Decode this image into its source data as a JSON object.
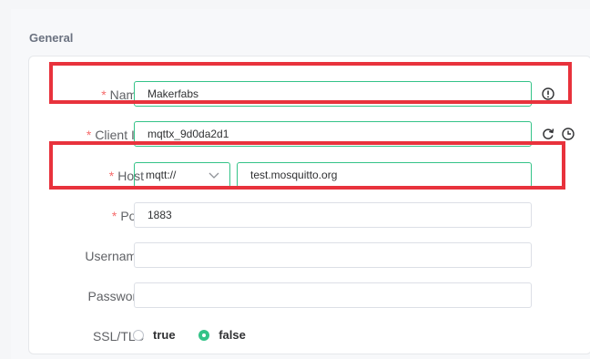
{
  "section": {
    "title": "General"
  },
  "form": {
    "required_mark": "*",
    "name": {
      "label": "Name",
      "value": "Makerfabs"
    },
    "client_id": {
      "label": "Client ID",
      "value": "mqttx_9d0da2d1"
    },
    "host": {
      "label": "Host",
      "protocol": "mqtt://",
      "value": "test.mosquitto.org"
    },
    "port": {
      "label": "Port",
      "value": "1883"
    },
    "username": {
      "label": "Username",
      "value": ""
    },
    "password": {
      "label": "Password",
      "value": ""
    },
    "ssl": {
      "label": "SSL/TLS",
      "options": [
        {
          "label": "true",
          "selected": false
        },
        {
          "label": "false",
          "selected": true
        }
      ]
    }
  },
  "icons": {
    "name_info": "info-icon",
    "refresh": "refresh-icon",
    "clock": "clock-icon",
    "chevron": "chevron-down-icon"
  },
  "colors": {
    "accent": "#34c388",
    "required": "#f56c6c",
    "highlight": "#e8323c"
  }
}
